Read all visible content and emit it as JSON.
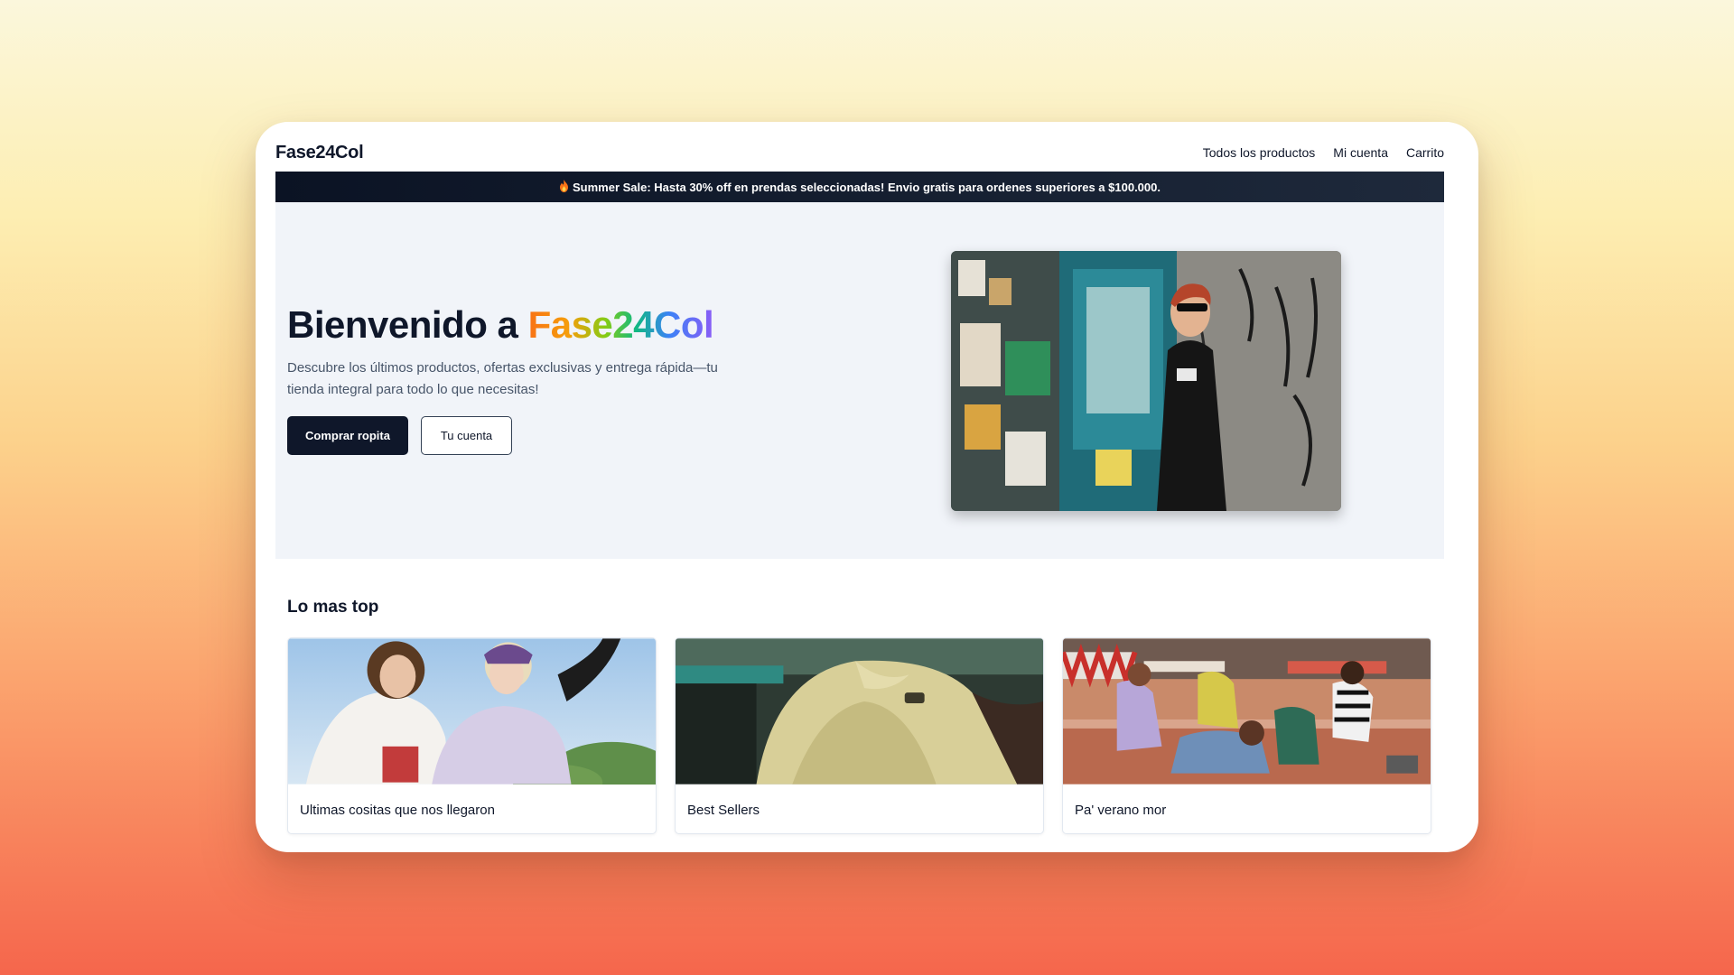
{
  "site": {
    "brand": "Fase24Col",
    "nav": [
      "Todos los productos",
      "Mi cuenta",
      "Carrito"
    ]
  },
  "promo": {
    "icon": "flame-icon",
    "text": "Summer Sale: Hasta 30% off en prendas seleccionadas! Envio gratis para ordenes superiores a $100.000."
  },
  "hero": {
    "title_prefix": "Bienvenido a ",
    "title_brand": "Fase24Col",
    "description": "Descubre los últimos productos, ofertas exclusivas y entrega rápida—tu tienda integral para todo lo que necesitas!",
    "primary_button": "Comprar ropita",
    "secondary_button": "Tu cuenta"
  },
  "featured": {
    "title": "Lo mas top",
    "cards": [
      {
        "label": "Ultimas cositas que nos llegaron"
      },
      {
        "label": "Best Sellers"
      },
      {
        "label": "Pa' verano mor"
      }
    ]
  },
  "colors": {
    "primary": "#0f172a",
    "hero_bg": "#f1f4f9",
    "promo_bg": "#0f172a"
  }
}
